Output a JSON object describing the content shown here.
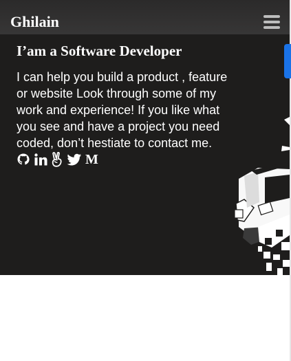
{
  "navbar": {
    "brand": "Ghilain",
    "menu_icon": "hamburger-menu-icon"
  },
  "hero": {
    "title": "I’am a Software Developer",
    "text": "I can help you build a product , feature or website Look through some of my work and experience! If you like what you see and have a project you need coded, don’t hestiate to contact me.",
    "socials": [
      {
        "name": "github",
        "icon": "github-icon"
      },
      {
        "name": "linkedin",
        "icon": "linkedin-icon"
      },
      {
        "name": "angellist",
        "icon": "angellist-icon"
      },
      {
        "name": "twitter",
        "icon": "twitter-icon"
      },
      {
        "name": "medium",
        "icon": "medium-icon",
        "glyph": "M"
      }
    ]
  },
  "colors": {
    "navbar_bg": "#2f2e2e",
    "hero_bg": "#1e1d1c",
    "text": "#ffffff",
    "accent": "#1a73e8"
  }
}
